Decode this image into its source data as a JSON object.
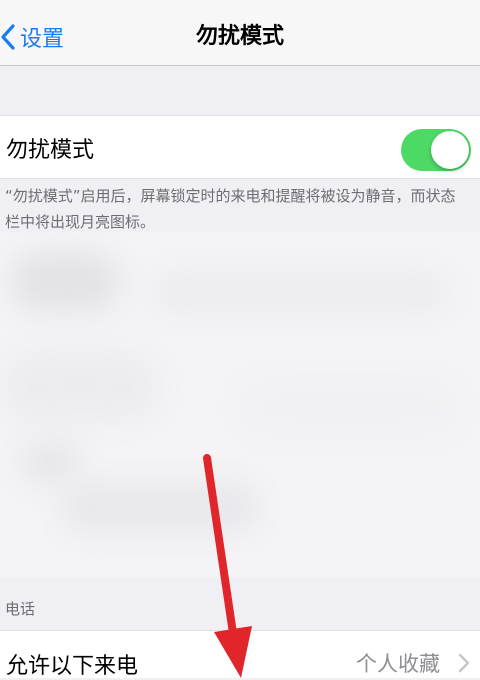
{
  "nav": {
    "back_label": "设置",
    "title": "勿扰模式"
  },
  "dnd": {
    "label": "勿扰模式",
    "toggle_on": true,
    "accent_color": "#4cd964",
    "footnote": "“勿扰模式”启用后，屏幕锁定时的来电和提醒将被设为静音，而状态栏中将出现月亮图标。"
  },
  "phone_section": {
    "header": "电话",
    "allow_calls_label": "允许以下来电",
    "allow_calls_value": "个人收藏"
  },
  "colors": {
    "link": "#1a7cf3",
    "annotation_arrow": "#e0262b"
  }
}
